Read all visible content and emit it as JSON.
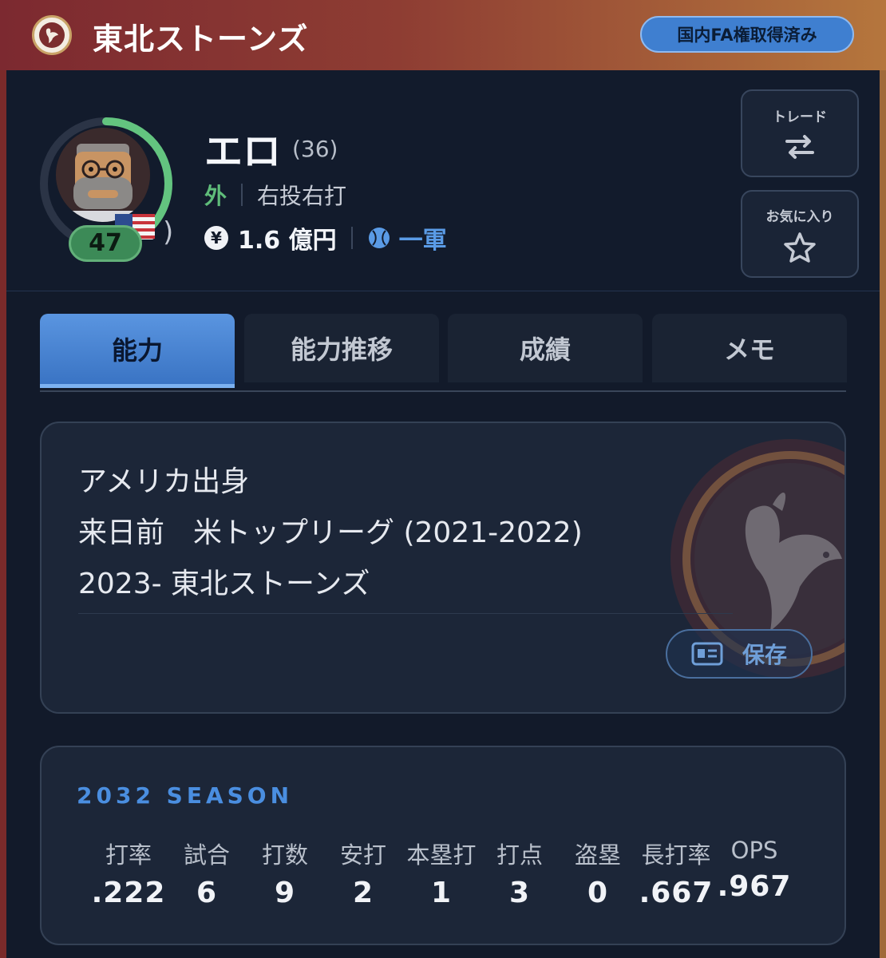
{
  "header": {
    "team_name": "東北ストーンズ",
    "fa_badge": "国内FA権取得済み"
  },
  "player": {
    "name": "エロ",
    "age": "(36)",
    "position": "外",
    "handedness": "右投右打",
    "salary": "1.6 億円",
    "level": "一軍",
    "number": "47",
    "overall_ring_fraction": 0.42
  },
  "side_buttons": {
    "trade_label": "トレード",
    "favorite_label": "お気に入り"
  },
  "tabs": [
    {
      "label": "能力",
      "active": true
    },
    {
      "label": "能力推移",
      "active": false
    },
    {
      "label": "成績",
      "active": false
    },
    {
      "label": "メモ",
      "active": false
    }
  ],
  "info": {
    "lines": [
      "アメリカ出身",
      "来日前　米トップリーグ (2021-2022)",
      "2023- 東北ストーンズ"
    ],
    "save_label": "保存"
  },
  "season": {
    "title": "2032 SEASON",
    "stats": [
      {
        "label": "打率",
        "value": ".222"
      },
      {
        "label": "試合",
        "value": "6"
      },
      {
        "label": "打数",
        "value": "9"
      },
      {
        "label": "安打",
        "value": "2"
      },
      {
        "label": "本塁打",
        "value": "1"
      },
      {
        "label": "打点",
        "value": "3"
      },
      {
        "label": "盗塁",
        "value": "0"
      },
      {
        "label": "長打率",
        "value": ".667"
      },
      {
        "label": "OPS",
        "value": ".967"
      }
    ]
  },
  "colors": {
    "accent_blue": "#3f7fd0",
    "position_green": "#5fbd7a",
    "level_blue": "#5a9be6"
  }
}
